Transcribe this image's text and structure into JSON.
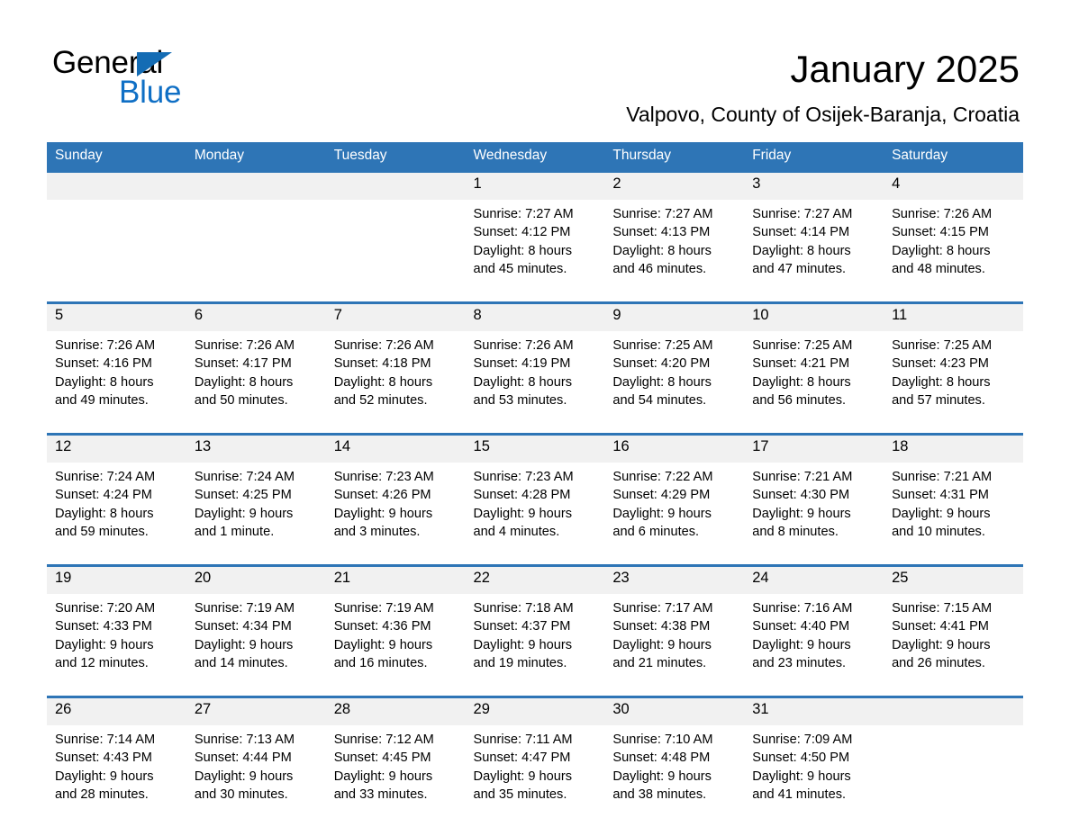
{
  "brand": {
    "name_part1": "General",
    "name_part2": "Blue",
    "triangle_icon": "blue-triangle-icon",
    "accent_color": "#0f6fc5"
  },
  "header": {
    "title": "January 2025",
    "subtitle": "Valpovo, County of Osijek-Baranja, Croatia"
  },
  "theme": {
    "header_blue": "#2e75b6",
    "daynum_gray": "#f1f1f1",
    "text_black": "#000000"
  },
  "calendar": {
    "weekday_headers": [
      "Sunday",
      "Monday",
      "Tuesday",
      "Wednesday",
      "Thursday",
      "Friday",
      "Saturday"
    ],
    "weeks": [
      [
        {
          "day": "",
          "lines": []
        },
        {
          "day": "",
          "lines": []
        },
        {
          "day": "",
          "lines": []
        },
        {
          "day": "1",
          "lines": [
            "Sunrise: 7:27 AM",
            "Sunset: 4:12 PM",
            "Daylight: 8 hours",
            "and 45 minutes."
          ]
        },
        {
          "day": "2",
          "lines": [
            "Sunrise: 7:27 AM",
            "Sunset: 4:13 PM",
            "Daylight: 8 hours",
            "and 46 minutes."
          ]
        },
        {
          "day": "3",
          "lines": [
            "Sunrise: 7:27 AM",
            "Sunset: 4:14 PM",
            "Daylight: 8 hours",
            "and 47 minutes."
          ]
        },
        {
          "day": "4",
          "lines": [
            "Sunrise: 7:26 AM",
            "Sunset: 4:15 PM",
            "Daylight: 8 hours",
            "and 48 minutes."
          ]
        }
      ],
      [
        {
          "day": "5",
          "lines": [
            "Sunrise: 7:26 AM",
            "Sunset: 4:16 PM",
            "Daylight: 8 hours",
            "and 49 minutes."
          ]
        },
        {
          "day": "6",
          "lines": [
            "Sunrise: 7:26 AM",
            "Sunset: 4:17 PM",
            "Daylight: 8 hours",
            "and 50 minutes."
          ]
        },
        {
          "day": "7",
          "lines": [
            "Sunrise: 7:26 AM",
            "Sunset: 4:18 PM",
            "Daylight: 8 hours",
            "and 52 minutes."
          ]
        },
        {
          "day": "8",
          "lines": [
            "Sunrise: 7:26 AM",
            "Sunset: 4:19 PM",
            "Daylight: 8 hours",
            "and 53 minutes."
          ]
        },
        {
          "day": "9",
          "lines": [
            "Sunrise: 7:25 AM",
            "Sunset: 4:20 PM",
            "Daylight: 8 hours",
            "and 54 minutes."
          ]
        },
        {
          "day": "10",
          "lines": [
            "Sunrise: 7:25 AM",
            "Sunset: 4:21 PM",
            "Daylight: 8 hours",
            "and 56 minutes."
          ]
        },
        {
          "day": "11",
          "lines": [
            "Sunrise: 7:25 AM",
            "Sunset: 4:23 PM",
            "Daylight: 8 hours",
            "and 57 minutes."
          ]
        }
      ],
      [
        {
          "day": "12",
          "lines": [
            "Sunrise: 7:24 AM",
            "Sunset: 4:24 PM",
            "Daylight: 8 hours",
            "and 59 minutes."
          ]
        },
        {
          "day": "13",
          "lines": [
            "Sunrise: 7:24 AM",
            "Sunset: 4:25 PM",
            "Daylight: 9 hours",
            "and 1 minute."
          ]
        },
        {
          "day": "14",
          "lines": [
            "Sunrise: 7:23 AM",
            "Sunset: 4:26 PM",
            "Daylight: 9 hours",
            "and 3 minutes."
          ]
        },
        {
          "day": "15",
          "lines": [
            "Sunrise: 7:23 AM",
            "Sunset: 4:28 PM",
            "Daylight: 9 hours",
            "and 4 minutes."
          ]
        },
        {
          "day": "16",
          "lines": [
            "Sunrise: 7:22 AM",
            "Sunset: 4:29 PM",
            "Daylight: 9 hours",
            "and 6 minutes."
          ]
        },
        {
          "day": "17",
          "lines": [
            "Sunrise: 7:21 AM",
            "Sunset: 4:30 PM",
            "Daylight: 9 hours",
            "and 8 minutes."
          ]
        },
        {
          "day": "18",
          "lines": [
            "Sunrise: 7:21 AM",
            "Sunset: 4:31 PM",
            "Daylight: 9 hours",
            "and 10 minutes."
          ]
        }
      ],
      [
        {
          "day": "19",
          "lines": [
            "Sunrise: 7:20 AM",
            "Sunset: 4:33 PM",
            "Daylight: 9 hours",
            "and 12 minutes."
          ]
        },
        {
          "day": "20",
          "lines": [
            "Sunrise: 7:19 AM",
            "Sunset: 4:34 PM",
            "Daylight: 9 hours",
            "and 14 minutes."
          ]
        },
        {
          "day": "21",
          "lines": [
            "Sunrise: 7:19 AM",
            "Sunset: 4:36 PM",
            "Daylight: 9 hours",
            "and 16 minutes."
          ]
        },
        {
          "day": "22",
          "lines": [
            "Sunrise: 7:18 AM",
            "Sunset: 4:37 PM",
            "Daylight: 9 hours",
            "and 19 minutes."
          ]
        },
        {
          "day": "23",
          "lines": [
            "Sunrise: 7:17 AM",
            "Sunset: 4:38 PM",
            "Daylight: 9 hours",
            "and 21 minutes."
          ]
        },
        {
          "day": "24",
          "lines": [
            "Sunrise: 7:16 AM",
            "Sunset: 4:40 PM",
            "Daylight: 9 hours",
            "and 23 minutes."
          ]
        },
        {
          "day": "25",
          "lines": [
            "Sunrise: 7:15 AM",
            "Sunset: 4:41 PM",
            "Daylight: 9 hours",
            "and 26 minutes."
          ]
        }
      ],
      [
        {
          "day": "26",
          "lines": [
            "Sunrise: 7:14 AM",
            "Sunset: 4:43 PM",
            "Daylight: 9 hours",
            "and 28 minutes."
          ]
        },
        {
          "day": "27",
          "lines": [
            "Sunrise: 7:13 AM",
            "Sunset: 4:44 PM",
            "Daylight: 9 hours",
            "and 30 minutes."
          ]
        },
        {
          "day": "28",
          "lines": [
            "Sunrise: 7:12 AM",
            "Sunset: 4:45 PM",
            "Daylight: 9 hours",
            "and 33 minutes."
          ]
        },
        {
          "day": "29",
          "lines": [
            "Sunrise: 7:11 AM",
            "Sunset: 4:47 PM",
            "Daylight: 9 hours",
            "and 35 minutes."
          ]
        },
        {
          "day": "30",
          "lines": [
            "Sunrise: 7:10 AM",
            "Sunset: 4:48 PM",
            "Daylight: 9 hours",
            "and 38 minutes."
          ]
        },
        {
          "day": "31",
          "lines": [
            "Sunrise: 7:09 AM",
            "Sunset: 4:50 PM",
            "Daylight: 9 hours",
            "and 41 minutes."
          ]
        },
        {
          "day": "",
          "lines": []
        }
      ]
    ]
  }
}
